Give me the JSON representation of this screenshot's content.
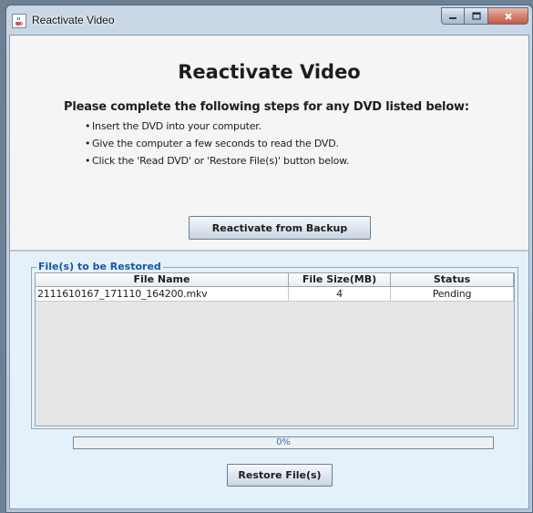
{
  "window": {
    "title": "Reactivate Video"
  },
  "main": {
    "heading": "Reactivate Video",
    "instructions": "Please complete the following steps for any DVD listed below:",
    "steps": [
      "Insert the DVD into your computer.",
      "Give the computer a few seconds to read the DVD.",
      "Click the 'Read DVD' or 'Restore File(s)' button below."
    ],
    "backup_button": "Reactivate from Backup"
  },
  "restore": {
    "legend": "File(s) to be Restored",
    "columns": [
      "File Name",
      "File Size(MB)",
      "Status"
    ],
    "rows": [
      {
        "file_name": "2111610167_171110_164200.mkv",
        "file_size": "4",
        "status": "Pending"
      }
    ],
    "progress_percent": 0,
    "progress_label": "0%",
    "restore_button": "Restore File(s)"
  },
  "icons": {
    "app": "java-cup-icon",
    "minimize": "minimize-icon",
    "maximize": "maximize-icon",
    "close": "close-icon"
  },
  "colors": {
    "legend": "#1a55a8",
    "progress_text": "#3a6db3",
    "panel_background": "#e4f0fa",
    "close_button": "#c55a44"
  }
}
